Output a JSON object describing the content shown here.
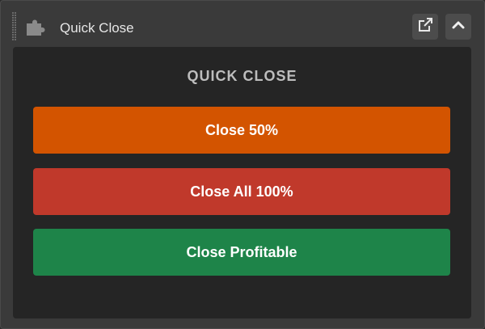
{
  "header": {
    "title": "Quick Close",
    "icons": {
      "widget": "puzzle-piece-icon",
      "popout": "external-link-icon",
      "collapse": "chevron-up-icon"
    }
  },
  "panel": {
    "section_title": "QUICK CLOSE",
    "actions": [
      {
        "label": "Close 50%",
        "color": "#d35400"
      },
      {
        "label": "Close All 100%",
        "color": "#c0392b"
      },
      {
        "label": "Close Profitable",
        "color": "#1e8449"
      }
    ]
  },
  "colors": {
    "frame_bg": "#3a3a3a",
    "panel_bg": "#252525",
    "title_text": "#e6e6e6",
    "section_text": "#bdbdbd"
  }
}
